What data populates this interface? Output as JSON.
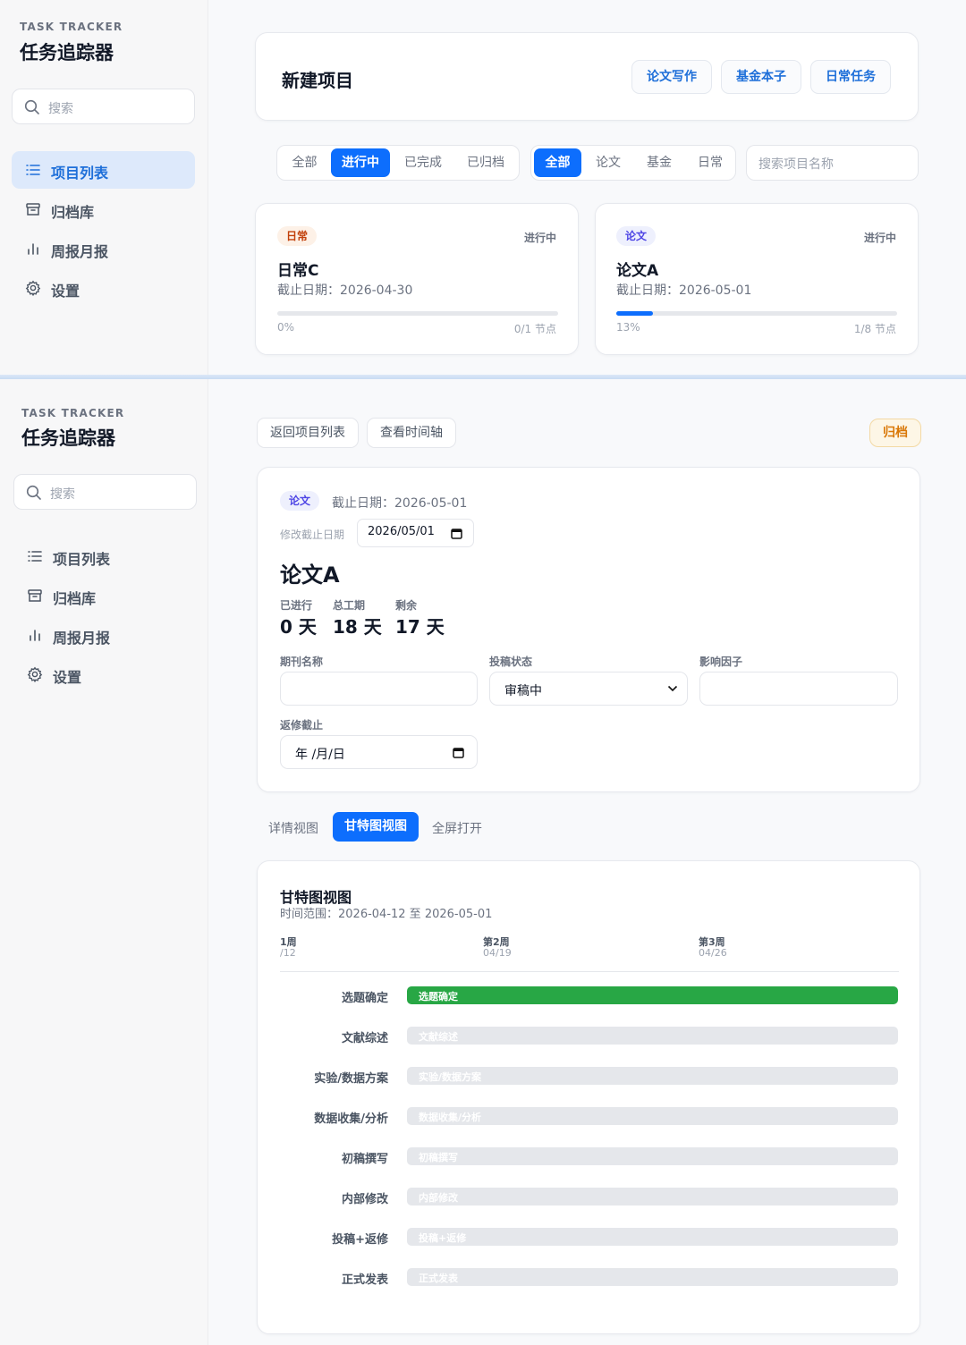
{
  "brand": {
    "small": "TASK TRACKER",
    "title": "任务追踪器"
  },
  "search": {
    "placeholder": "搜索"
  },
  "nav": {
    "items": [
      {
        "label": "项目列表",
        "icon": "list-icon"
      },
      {
        "label": "归档库",
        "icon": "archive-icon"
      },
      {
        "label": "周报月报",
        "icon": "bar-chart-icon"
      },
      {
        "label": "设置",
        "icon": "gear-icon"
      }
    ],
    "active_panel1": "项目列表"
  },
  "list_view": {
    "new_project_title": "新建项目",
    "templates": [
      "论文写作",
      "基金本子",
      "日常任务"
    ],
    "status_filters": [
      "全部",
      "进行中",
      "已完成",
      "已归档"
    ],
    "status_selected": "进行中",
    "type_filters": [
      "全部",
      "论文",
      "基金",
      "日常"
    ],
    "type_selected": "全部",
    "search_placeholder": "搜索项目名称",
    "projects": [
      {
        "tag": "日常",
        "tag_kind": "daily",
        "status": "进行中",
        "name": "日常C",
        "due": "截止日期：2026-04-30",
        "progress": 0,
        "percent_text": "0%",
        "nodes": "0/1 节点"
      },
      {
        "tag": "论文",
        "tag_kind": "paper",
        "status": "进行中",
        "name": "论文A",
        "due": "截止日期：2026-05-01",
        "progress": 13,
        "percent_text": "13%",
        "nodes": "1/8 节点"
      }
    ]
  },
  "detail_view": {
    "back_button": "返回项目列表",
    "timeline_button": "查看时间轴",
    "archive_button": "归档",
    "tag": "论文",
    "due": "截止日期：2026-05-01",
    "edit_due_label": "修改截止日期",
    "edit_due_value": "2026/05/01",
    "title": "论文A",
    "stats": [
      {
        "label": "已进行",
        "value": "0 天"
      },
      {
        "label": "总工期",
        "value": "18 天"
      },
      {
        "label": "剩余",
        "value": "17 天"
      }
    ],
    "fields": {
      "journal_label": "期刊名称",
      "journal_value": "",
      "submission_label": "投稿状态",
      "submission_value": "审稿中",
      "impact_label": "影响因子",
      "impact_value": "",
      "revision_label": "返修截止",
      "revision_placeholder": "年 /月/日"
    },
    "view_tabs": [
      "详情视图",
      "甘特图视图",
      "全屏打开"
    ],
    "view_selected": "甘特图视图",
    "gantt": {
      "title": "甘特图视图",
      "range": "时间范围：2026-04-12 至 2026-05-01",
      "weeks": [
        {
          "label": "1周",
          "date": "/12"
        },
        {
          "label": "第2周",
          "date": "04/19"
        },
        {
          "label": "第3周",
          "date": "04/26"
        }
      ],
      "tasks": [
        {
          "name": "选题确定",
          "done": true
        },
        {
          "name": "文献综述",
          "done": false
        },
        {
          "name": "实验/数据方案",
          "done": false
        },
        {
          "name": "数据收集/分析",
          "done": false
        },
        {
          "name": "初稿撰写",
          "done": false
        },
        {
          "name": "内部修改",
          "done": false
        },
        {
          "name": "投稿+返修",
          "done": false
        },
        {
          "name": "正式发表",
          "done": false
        }
      ]
    }
  }
}
